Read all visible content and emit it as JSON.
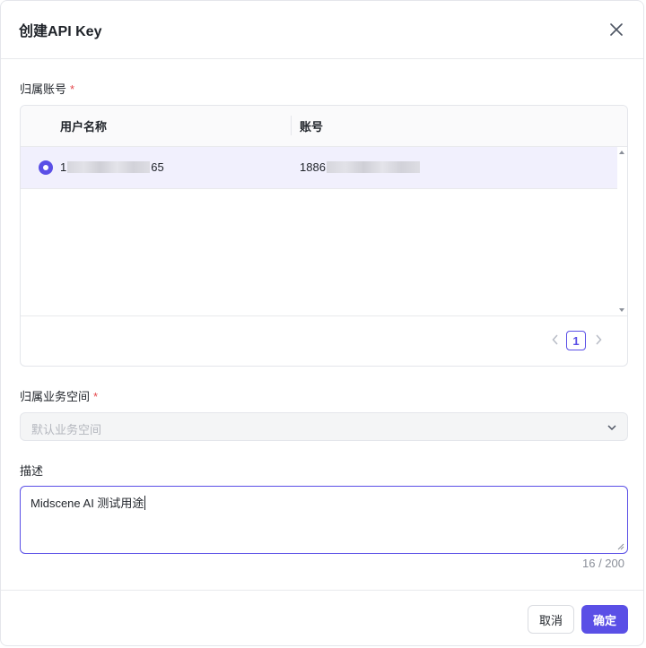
{
  "dialog": {
    "title": "创建API Key",
    "close_icon": "close-icon"
  },
  "account": {
    "label": "归属账号",
    "required_mark": "*",
    "columns": [
      "用户名称",
      "账号"
    ],
    "rows": [
      {
        "selected": true,
        "username_prefix": "1",
        "username_suffix": "65",
        "account_prefix": "1886",
        "account_suffix": ""
      }
    ],
    "pagination": {
      "current_page": "1"
    }
  },
  "workspace": {
    "label": "归属业务空间",
    "required_mark": "*",
    "placeholder": "默认业务空间",
    "chevron_icon": "chevron-down-icon"
  },
  "description": {
    "label": "描述",
    "value": "Midscene AI 测试用途",
    "counter": "16 / 200"
  },
  "actions": {
    "cancel_label": "取消",
    "confirm_label": "确定"
  },
  "colors": {
    "accent": "#5a4fe6",
    "selected_row_bg": "#f1f0fd",
    "required": "#e5484d"
  }
}
